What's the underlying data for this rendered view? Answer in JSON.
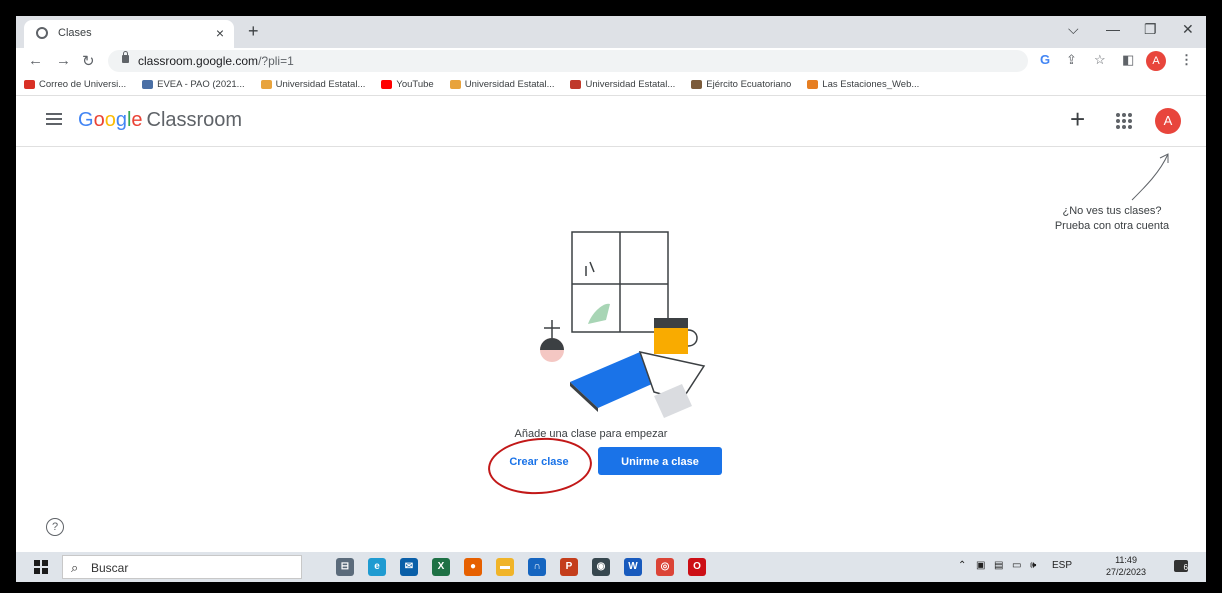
{
  "browser": {
    "tab_title": "Clases",
    "tab_close": "×",
    "new_tab": "+",
    "window_controls": [
      "⌵",
      "—",
      "❐",
      "✕"
    ],
    "url_host": "classroom.google.com",
    "url_rest": "/?pli=1",
    "profile_initial": "A"
  },
  "bookmarks": [
    {
      "label": "Correo de Universi...",
      "icon": "gmail-icon",
      "color": "#d93025"
    },
    {
      "label": "EVEA - PAO (2021...",
      "icon": "evea-icon",
      "color": "#4a6fa5"
    },
    {
      "label": "Universidad Estatal...",
      "icon": "university-icon",
      "color": "#e8a33c"
    },
    {
      "label": "YouTube",
      "icon": "youtube-icon",
      "color": "#ff0000"
    },
    {
      "label": "Universidad Estatal...",
      "icon": "university-icon",
      "color": "#e8a33c"
    },
    {
      "label": "Universidad Estatal...",
      "icon": "university-shield-icon",
      "color": "#c0392b"
    },
    {
      "label": "Ejército Ecuatoriano",
      "icon": "army-icon",
      "color": "#7b5b3a"
    },
    {
      "label": "Las Estaciones_Web...",
      "icon": "stations-icon",
      "color": "#e67e22"
    }
  ],
  "classroom": {
    "logo_letters": [
      "G",
      "o",
      "o",
      "g",
      "l",
      "e"
    ],
    "product": "Classroom",
    "plus_label": "+",
    "avatar_initial": "A",
    "hint_line1": "¿No ves tus clases?",
    "hint_line2": "Prueba con otra cuenta",
    "empty_message": "Añade una clase para empezar",
    "create_button": "Crear clase",
    "join_button": "Unirme a clase",
    "help_label": "?"
  },
  "taskbar": {
    "search_placeholder": "Buscar",
    "tray_language": "ESP",
    "time": "11:49",
    "date": "27/2/2023",
    "notifications": "6",
    "apps": [
      {
        "name": "task-view-icon",
        "color": "#5b6b7b",
        "glyph": "⊟"
      },
      {
        "name": "edge-icon",
        "color": "#1f9bd1",
        "glyph": "e"
      },
      {
        "name": "mail-icon",
        "color": "#0a5fa8",
        "glyph": "✉"
      },
      {
        "name": "excel-icon",
        "color": "#1e7145",
        "glyph": "X"
      },
      {
        "name": "firefox-icon",
        "color": "#e66000",
        "glyph": "●"
      },
      {
        "name": "file-explorer-icon",
        "color": "#f0b429",
        "glyph": "▬"
      },
      {
        "name": "headphones-icon",
        "color": "#1565c0",
        "glyph": "∩"
      },
      {
        "name": "powerpoint-icon",
        "color": "#c43e1c",
        "glyph": "P"
      },
      {
        "name": "camera-icon",
        "color": "#37474f",
        "glyph": "◉"
      },
      {
        "name": "word-icon",
        "color": "#185abd",
        "glyph": "W"
      },
      {
        "name": "chrome-icon",
        "color": "#db4437",
        "glyph": "◎"
      },
      {
        "name": "opera-icon",
        "color": "#cc0f16",
        "glyph": "O"
      }
    ]
  },
  "colors": {
    "accent_blue": "#1a73e8",
    "annotation_red": "#c21818",
    "avatar_red": "#e8453c"
  }
}
